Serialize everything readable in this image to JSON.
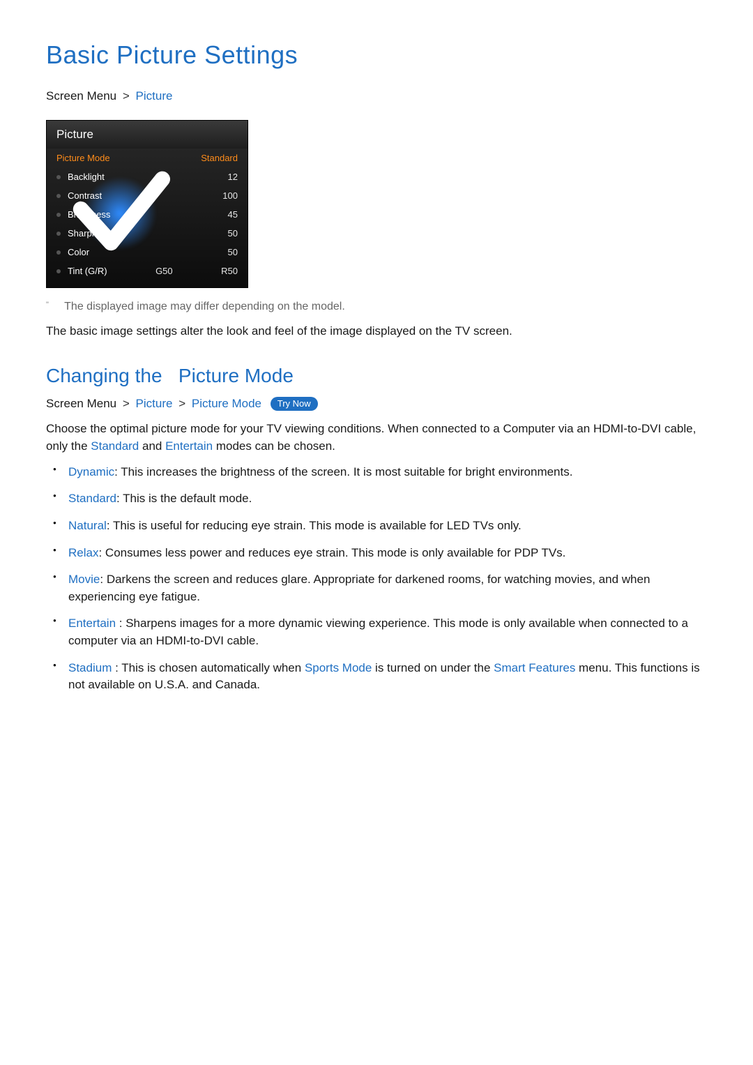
{
  "title": "Basic Picture Settings",
  "breadcrumb1": {
    "root": "Screen Menu",
    "sep": ">",
    "leaf": "Picture"
  },
  "panel": {
    "header": "Picture",
    "rows": [
      {
        "label": "Picture Mode",
        "value": "Standard",
        "highlight": true
      },
      {
        "label": "Backlight",
        "value": "12"
      },
      {
        "label": "Contrast",
        "value": "100"
      },
      {
        "label": "Brightness",
        "value": "45"
      },
      {
        "label": "Sharpness",
        "value": "50"
      },
      {
        "label": "Color",
        "value": "50"
      },
      {
        "label": "Tint (G/R)",
        "mid": "G50",
        "value": "R50"
      }
    ]
  },
  "note": "The displayed image may differ depending on the model.",
  "paragraph": "The basic image settings alter the look and feel of the image displayed on the TV screen.",
  "section2": {
    "title_a": "Changing the ",
    "title_b": "Picture Mode",
    "breadcrumb": {
      "root": "Screen Menu",
      "sep": ">",
      "l1": "Picture",
      "l2": "Picture Mode",
      "try": "Try Now"
    },
    "intro_a": "Choose the optimal picture mode for your TV viewing conditions. When connected to a Computer via an HDMI-to-DVI cable, only the ",
    "intro_b": "Standard",
    "intro_c": " and ",
    "intro_d": "Entertain",
    "intro_e": "  modes can be chosen.",
    "modes": [
      {
        "name": "Dynamic",
        "sep": ": ",
        "text": "This increases the brightness of the screen. It is most suitable for bright environments."
      },
      {
        "name": "Standard",
        "sep": ": ",
        "text": "This is the default mode."
      },
      {
        "name": "Natural",
        "sep": ": ",
        "text": "This is useful for reducing eye strain. This mode is available for LED TVs only."
      },
      {
        "name": "Relax",
        "sep": ": ",
        "text": "Consumes less power and reduces eye strain. This mode is only available for PDP TVs."
      },
      {
        "name": "Movie",
        "sep": ": ",
        "text": "Darkens the screen and reduces glare. Appropriate for darkened rooms, for watching movies, and when experiencing eye fatigue."
      },
      {
        "name": "Entertain",
        "sep": " : ",
        "text": "Sharpens images for a more dynamic viewing experience. This mode is only available when connected to a computer via an HDMI-to-DVI cable."
      }
    ],
    "stadium": {
      "name": "Stadium",
      "sep": " : ",
      "t1": "This is chosen automatically when ",
      "k1": "Sports Mode",
      "t2": "  is turned on under the ",
      "k2": "Smart Features",
      "t3": " menu. This functions is not available on U.S.A. and Canada."
    }
  }
}
